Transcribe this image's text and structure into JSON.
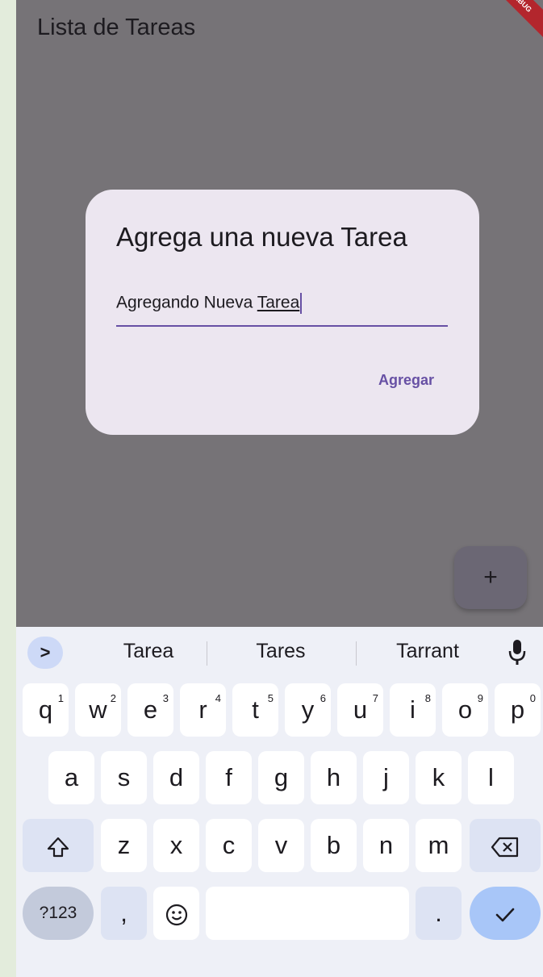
{
  "app": {
    "title": "Lista de Tareas",
    "debug_banner": "DEBUG"
  },
  "dialog": {
    "title": "Agrega una nueva Tarea",
    "input_value_prefix": "Agregando Nueva ",
    "input_value_current_word": "Tarea",
    "action_label": "Agregar"
  },
  "fab": {
    "label": "+"
  },
  "keyboard": {
    "expand_icon": ">",
    "suggestions": [
      "Tarea",
      "Tares",
      "Tarrant"
    ],
    "row1": [
      "q",
      "w",
      "e",
      "r",
      "t",
      "y",
      "u",
      "i",
      "o",
      "p"
    ],
    "row1_hints": [
      "1",
      "2",
      "3",
      "4",
      "5",
      "6",
      "7",
      "8",
      "9",
      "0"
    ],
    "row2": [
      "a",
      "s",
      "d",
      "f",
      "g",
      "h",
      "j",
      "k",
      "l"
    ],
    "row3": [
      "z",
      "x",
      "c",
      "v",
      "b",
      "n",
      "m"
    ],
    "symbols_label": "?123",
    "comma": ",",
    "period": ".",
    "colors": {
      "enter": "#a8c6f8",
      "accent": "#6750a4"
    }
  }
}
